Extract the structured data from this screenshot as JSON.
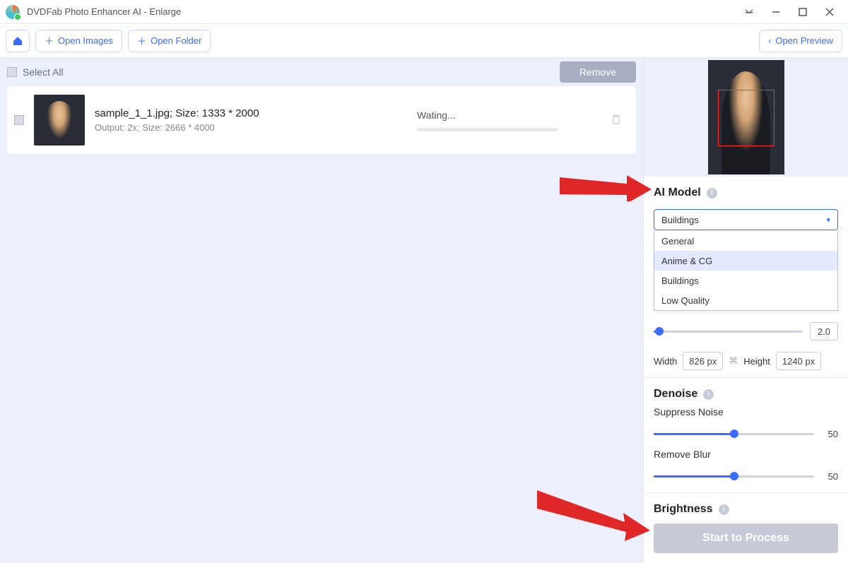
{
  "app": {
    "title": "DVDFab Photo Enhancer AI - Enlarge"
  },
  "toolbar": {
    "open_images": "Open Images",
    "open_folder": "Open Folder",
    "open_preview": "Open Preview"
  },
  "list": {
    "select_all": "Select All",
    "remove": "Remove"
  },
  "file": {
    "name_line": "sample_1_1.jpg; Size: 1333 * 2000",
    "output_line": "Output: 2x; Size: 2666 * 4000",
    "status": "Wating..."
  },
  "panel": {
    "ai_model": {
      "title": "AI Model"
    },
    "dropdown": {
      "selected": "Buildings",
      "items": [
        "General",
        "Anime & CG",
        "Buildings",
        "Low Quality"
      ]
    },
    "scale": {
      "value": "2.0"
    },
    "dims": {
      "width_label": "Width",
      "width_value": "826 px",
      "height_label": "Height",
      "height_value": "1240 px"
    },
    "denoise": {
      "title": "Denoise",
      "suppress_label": "Suppress Noise",
      "suppress_value": "50",
      "blur_label": "Remove Blur",
      "blur_value": "50"
    },
    "brightness": {
      "title": "Brightness"
    },
    "process_btn": "Start to Process"
  }
}
